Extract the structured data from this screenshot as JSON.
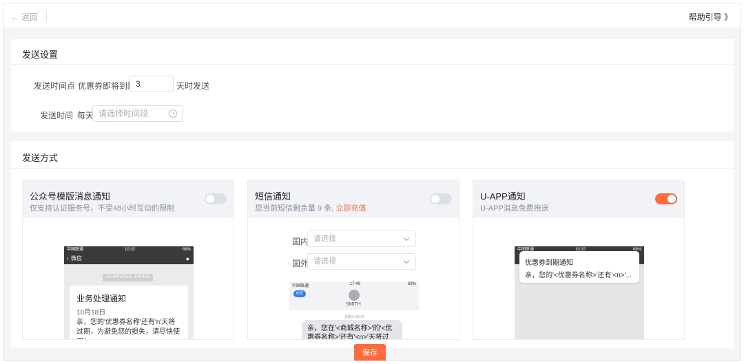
{
  "topbar": {
    "back_label": "返回",
    "back_arrow": "←",
    "help_label": "帮助引导 》"
  },
  "settings": {
    "title": "发送设置",
    "time_point_label": "发送时间点",
    "time_point_prefix": "优惠券即将到期前",
    "days_value": "3",
    "time_point_suffix": "天时发送",
    "send_time_label": "发送时间",
    "every_day": "每天",
    "time_placeholder": "请选择时间段"
  },
  "methods": {
    "title": "发送方式",
    "wechat": {
      "title": "公众号模版消息通知",
      "desc": "仅支持认证服务号，不受48小时互动的限制",
      "enabled": false,
      "preview": {
        "carrier": "中国联通",
        "time": "10:32",
        "battery": "68%",
        "back_label": "微信",
        "date_chip": "2018年5月2日 上午9:11",
        "msg_title": "业务处理通知",
        "msg_date": "10月18日",
        "msg_body": "亲，您的'优惠券名称'还有'n'天将过期，为避免您的损失，请尽快使用！"
      }
    },
    "sms": {
      "title": "短信通知",
      "desc_prefix": "您当前短信剩余量 9 条,",
      "desc_link": "立即充值",
      "enabled": false,
      "domestic_label": "国内",
      "domestic_placeholder": "请选择",
      "foreign_label": "国外",
      "foreign_placeholder": "请选择",
      "preview": {
        "carrier": "中国联通",
        "time": "17:49",
        "battery": "69%",
        "back_count": "605",
        "contact": "SMITH",
        "msg_time": "星期六 09:02",
        "msg_body": "亲，您在'<商城名称>'的'<优惠券名称>'还有'<n>'天将过"
      }
    },
    "uapp": {
      "title": "U-APP通知",
      "desc": "U-APP消息免费推送",
      "enabled": true,
      "preview": {
        "carrier": "中国联通",
        "time": "10:32",
        "battery": "68%",
        "notif_title": "优惠券到期通知",
        "notif_body": "亲，您的'<优惠券名称>'还有'<n>'..."
      }
    }
  },
  "footer": {
    "save_label": "保存"
  },
  "colors": {
    "accent": "#ff6a3c",
    "toggle_off": "#dcdfe4",
    "page_bg": "#f4f5f7"
  }
}
